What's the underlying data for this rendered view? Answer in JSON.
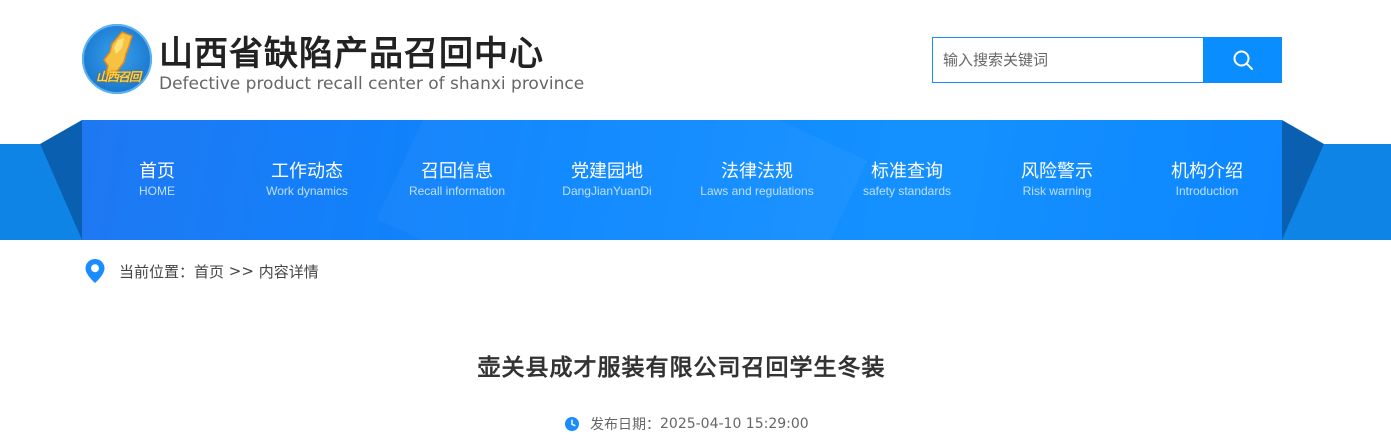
{
  "header": {
    "site_title": "山西省缺陷产品召回中心",
    "site_subtitle": "Defective product recall center of shanxi province",
    "emblem_text": "山西召回",
    "search": {
      "placeholder": "输入搜索关键词",
      "value": "",
      "button_icon": "search-icon"
    }
  },
  "nav": {
    "items": [
      {
        "cn": "首页",
        "en": "HOME"
      },
      {
        "cn": "工作动态",
        "en": "Work dynamics"
      },
      {
        "cn": "召回信息",
        "en": "Recall information"
      },
      {
        "cn": "党建园地",
        "en": "DangJianYuanDi"
      },
      {
        "cn": "法律法规",
        "en": "Laws and regulations"
      },
      {
        "cn": "标准查询",
        "en": "safety standards"
      },
      {
        "cn": "风险警示",
        "en": "Risk warning"
      },
      {
        "cn": "机构介绍",
        "en": "Introduction"
      }
    ]
  },
  "breadcrumb": {
    "prefix": "当前位置：",
    "home": "首页",
    "separator": " >> ",
    "current": "内容详情",
    "icon": "location-pin-icon"
  },
  "article": {
    "title": "壶关县成才服装有限公司召回学生冬装",
    "publish_label": "发布日期：",
    "publish_date": "2025-04-10 15:29:00",
    "date_icon": "clock-icon"
  },
  "colors": {
    "nav_blue": "#0a86ff",
    "band_blue": "#0d84e6",
    "fold_blue": "#0a5fb0",
    "search_button": "#0a8dff",
    "pin_blue": "#1a8cff"
  }
}
